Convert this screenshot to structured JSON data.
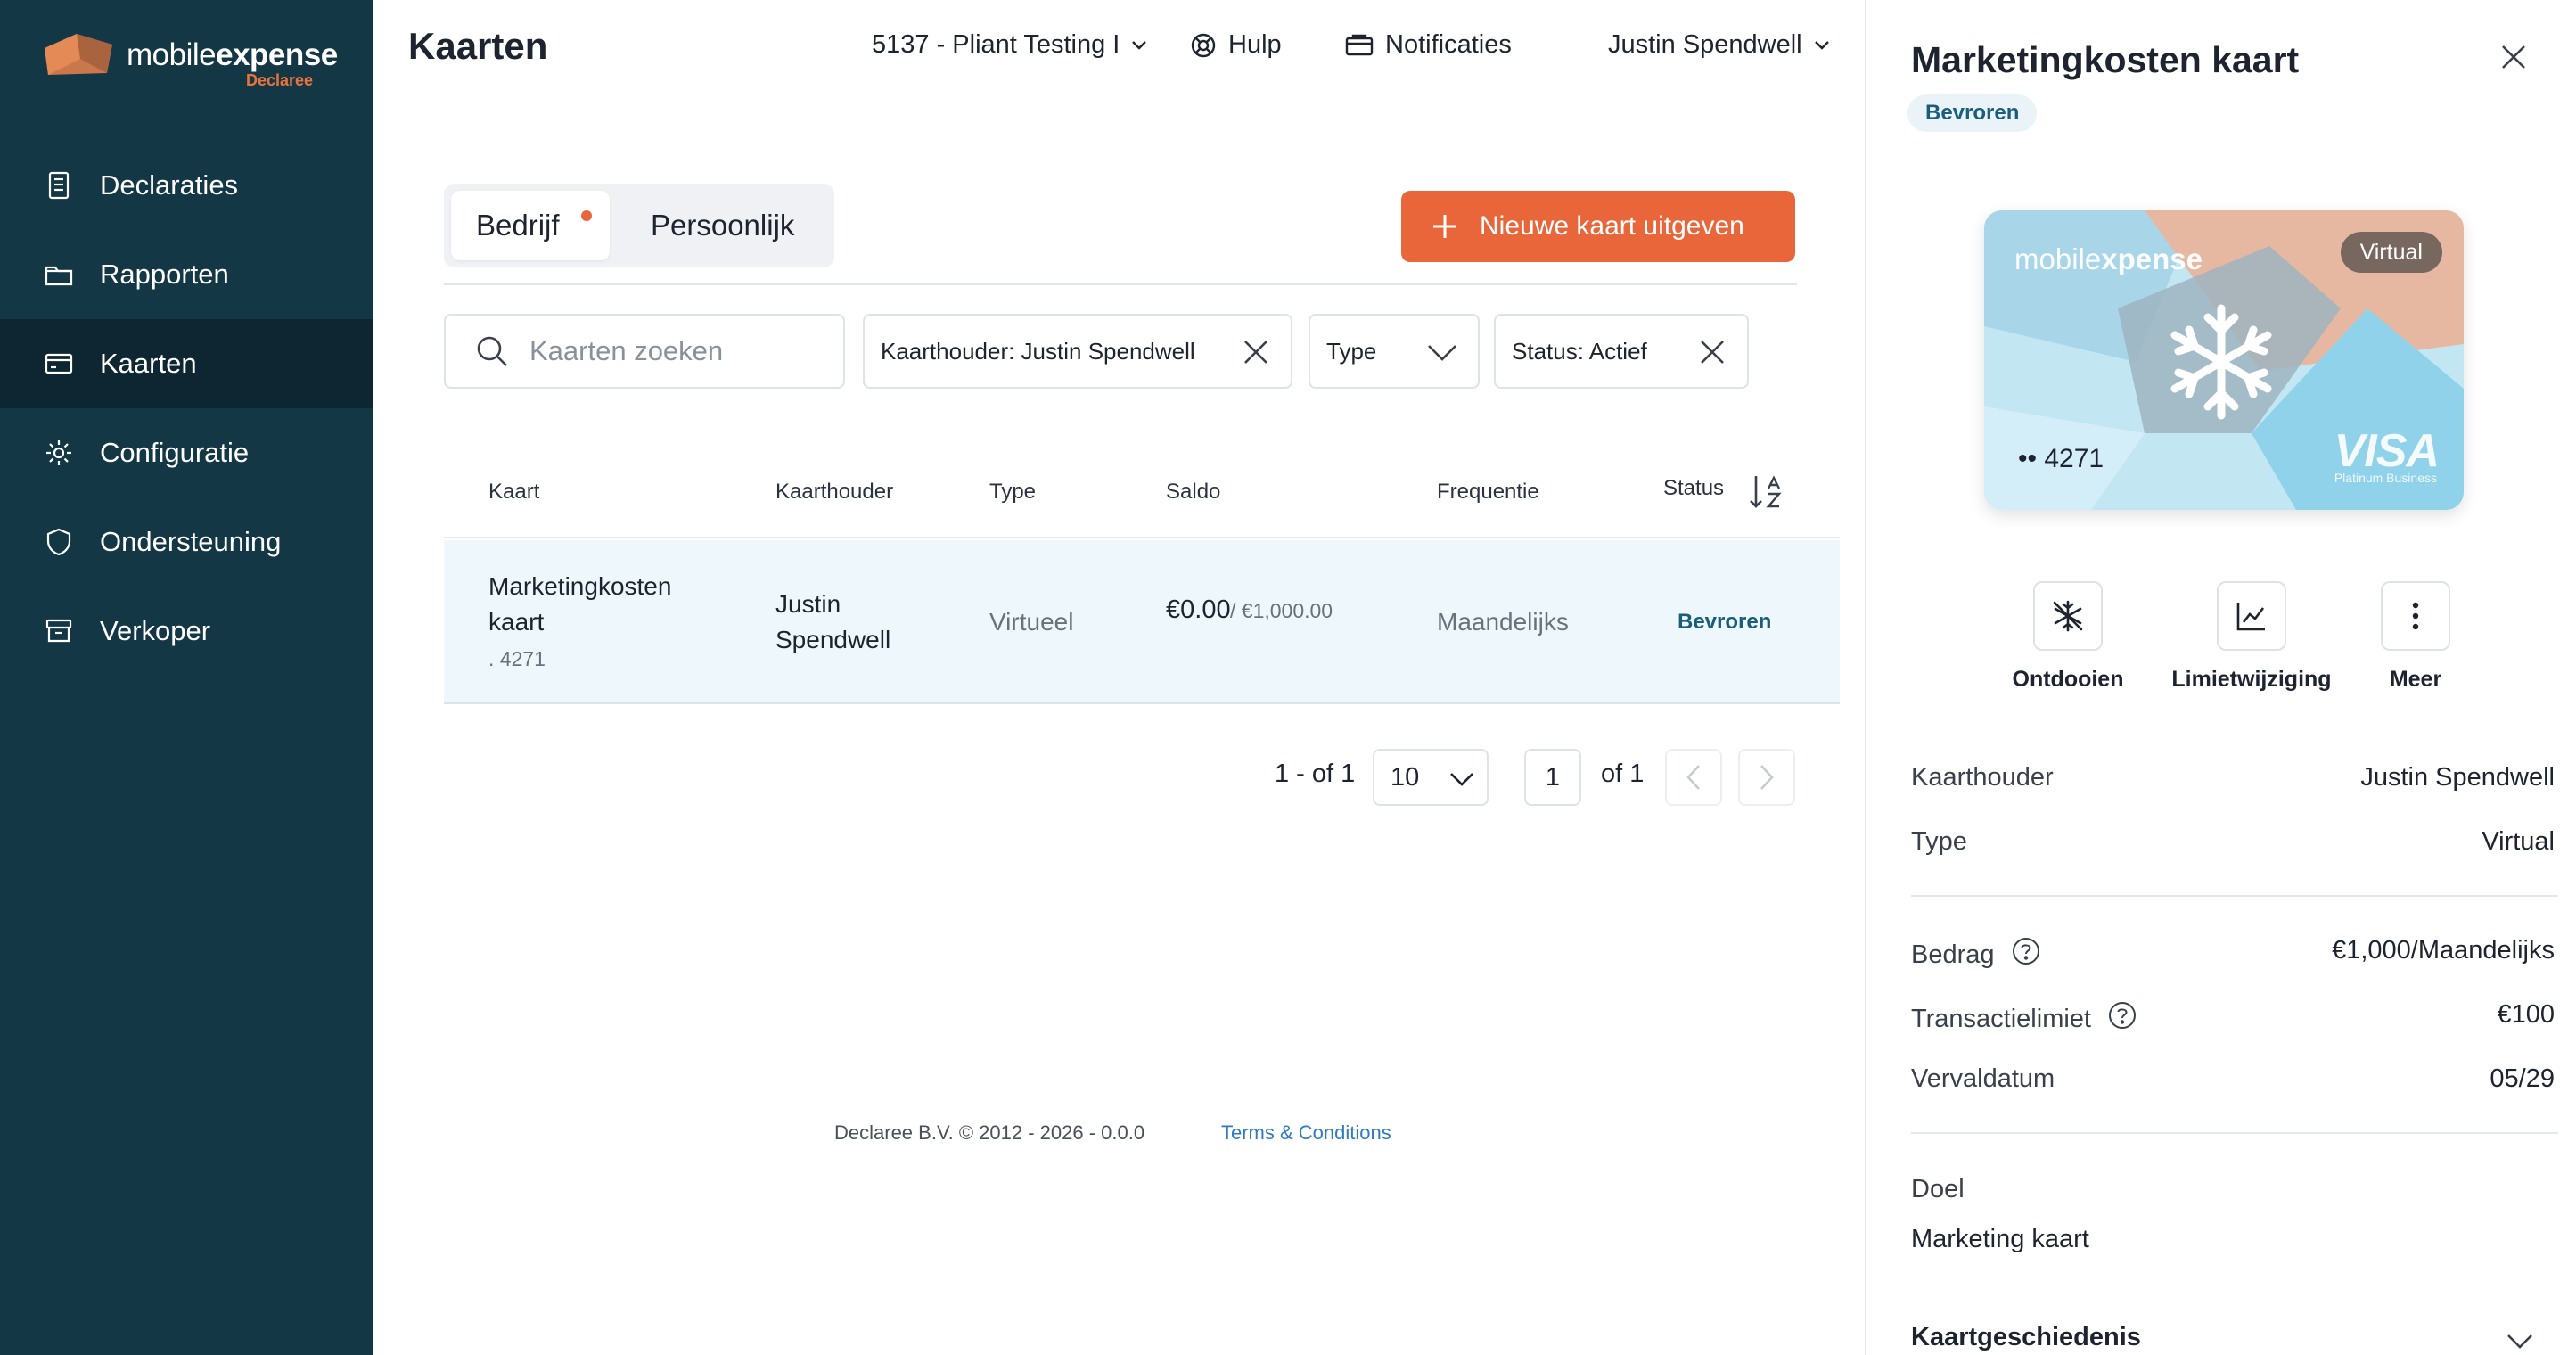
{
  "brand": {
    "name_light": "mobile",
    "name_bold": "expense",
    "sub": "Declaree"
  },
  "sidebar": {
    "items": [
      {
        "label": "Declaraties",
        "icon": "receipt-icon"
      },
      {
        "label": "Rapporten",
        "icon": "folder-icon"
      },
      {
        "label": "Kaarten",
        "icon": "credit-card-icon",
        "active": true
      },
      {
        "label": "Configuratie",
        "icon": "gear-icon"
      },
      {
        "label": "Ondersteuning",
        "icon": "shield-icon"
      },
      {
        "label": "Verkoper",
        "icon": "archive-icon"
      }
    ]
  },
  "header": {
    "title": "Kaarten",
    "company": "5137 - Pliant Testing I",
    "help": "Hulp",
    "notifications": "Notificaties",
    "user": "Justin Spendwell"
  },
  "tabs": {
    "company": "Bedrijf",
    "personal": "Persoonlijk"
  },
  "new_card_button": "Nieuwe kaart uitgeven",
  "filters": {
    "search_placeholder": "Kaarten zoeken",
    "cardholder": "Kaarthouder: Justin Spendwell",
    "type": "Type",
    "status": "Status: Actief"
  },
  "table": {
    "columns": [
      "Kaart",
      "Kaarthouder",
      "Type",
      "Saldo",
      "Frequentie",
      "Status"
    ],
    "rows": [
      {
        "card_line1": "Marketingkosten",
        "card_line2": "kaart",
        "card_number": ". 4271",
        "holder_line1": "Justin",
        "holder_line2": "Spendwell",
        "type": "Virtueel",
        "balance": "€0.00",
        "limit": "/ €1,000.00",
        "frequency": "Maandelijks",
        "status": "Bevroren"
      }
    ]
  },
  "pagination": {
    "range": "1 - of 1",
    "per_page": "10",
    "page": "1",
    "of": "of 1"
  },
  "footer": {
    "copyright": "Declaree B.V. © 2012 - 2026 - 0.0.0",
    "terms": "Terms & Conditions"
  },
  "panel": {
    "title": "Marketingkosten kaart",
    "badge": "Bevroren",
    "card": {
      "brand_light": "mobile",
      "brand_bold": "xpense",
      "virtual_label": "Virtual",
      "number": "•• 4271",
      "network": "VISA",
      "network_sub": "Platinum Business"
    },
    "actions": [
      {
        "label": "Ontdooien",
        "icon": "snowflake-off-icon"
      },
      {
        "label": "Limietwijziging",
        "icon": "chart-line-icon"
      },
      {
        "label": "Meer",
        "icon": "more-vertical-icon"
      }
    ],
    "details": {
      "holder_label": "Kaarthouder",
      "holder_value": "Justin Spendwell",
      "type_label": "Type",
      "type_value": "Virtual",
      "amount_label": "Bedrag",
      "amount_value": "€1,000/Maandelijks",
      "tx_limit_label": "Transactielimiet",
      "tx_limit_value": "€100",
      "expiry_label": "Vervaldatum",
      "expiry_value": "05/29",
      "purpose_label": "Doel",
      "purpose_value": "Marketing kaart",
      "history_label": "Kaartgeschiedenis"
    }
  },
  "colors": {
    "sidebar": "#143746",
    "accent": "#e8663a",
    "row_highlight": "#eef8fc",
    "status_frozen": "#1b5d7a"
  }
}
